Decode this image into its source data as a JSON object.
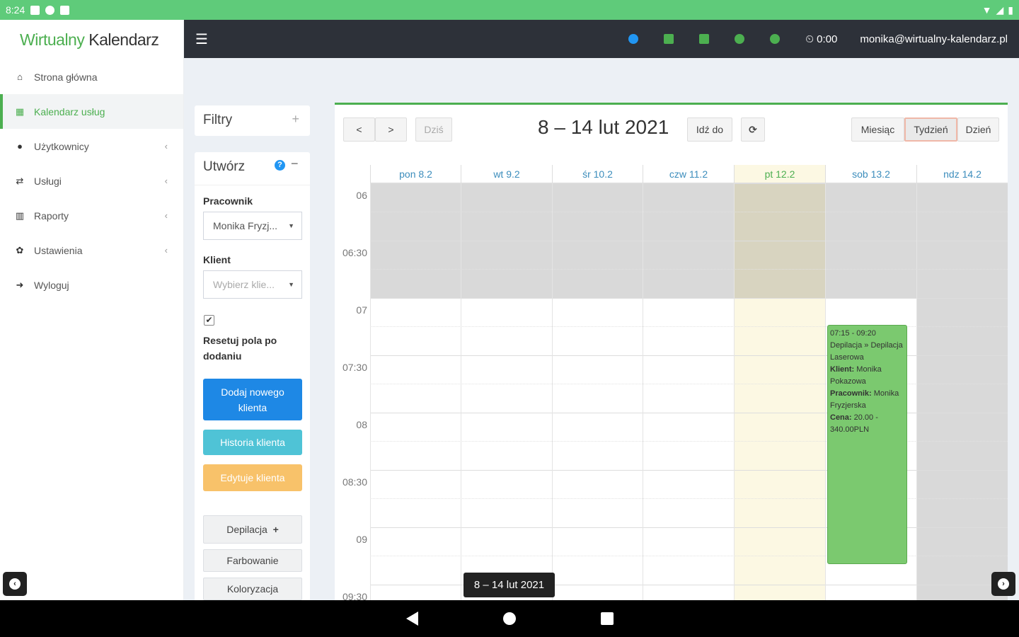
{
  "status": {
    "time": "8:24"
  },
  "sidebar": {
    "logo_green": "Wirtualny",
    "logo_dark": "Kalendarz",
    "items": [
      {
        "label": "Strona główna",
        "icon": "home-icon"
      },
      {
        "label": "Kalendarz usług",
        "icon": "calendar-icon"
      },
      {
        "label": "Użytkownicy",
        "icon": "user-icon"
      },
      {
        "label": "Usługi",
        "icon": "services-icon"
      },
      {
        "label": "Raporty",
        "icon": "bar-chart-icon"
      },
      {
        "label": "Ustawienia",
        "icon": "gear-icon"
      },
      {
        "label": "Wyloguj",
        "icon": "sign-out-icon"
      }
    ]
  },
  "topbar": {
    "timer": "0:00",
    "email": "monika@wirtualny-kalendarz.pl",
    "icon_colors": [
      "#2196f3",
      "#4caf50",
      "#4caf50",
      "#4caf50",
      "#4caf50"
    ]
  },
  "filters": {
    "title": "Filtry",
    "toggle": "+"
  },
  "create": {
    "title": "Utwórz",
    "collapse": "−",
    "employee_label": "Pracownik",
    "employee_value": "Monika Fryzj...",
    "client_label": "Klient",
    "client_placeholder": "Wybierz klie...",
    "reset_label_1": "Resetuj pola po",
    "reset_label_2": "dodaniu",
    "btn_add_1": "Dodaj nowego",
    "btn_add_2": "klienta",
    "btn_history": "Historia klienta",
    "btn_edit": "Edytuje klienta",
    "services": [
      "Depilacja",
      "Farbowanie",
      "Koloryzacja"
    ]
  },
  "calendar": {
    "prev": "<",
    "next": ">",
    "today": "Dziś",
    "title": "8 – 14 lut 2021",
    "goto": "Idź do",
    "refresh": "⟳",
    "views": [
      "Miesiąc",
      "Tydzień",
      "Dzień"
    ],
    "days": [
      "pon 8.2",
      "wt 9.2",
      "śr 10.2",
      "czw 11.2",
      "pt 12.2",
      "sob 13.2",
      "ndz 14.2"
    ],
    "times": [
      "06",
      "06:30",
      "07",
      "07:30",
      "08",
      "08:30",
      "09",
      "09:30"
    ],
    "event": {
      "time": "07:15 - 09:20",
      "service": "Depilacja » Depilacja Laserowa",
      "client_label": "Klient:",
      "client": "Monika Pokazowa",
      "worker_label": "Pracownik:",
      "worker": "Monika Fryzjerska",
      "price_label": "Cena:",
      "price": "20.00 - 340.00PLN"
    },
    "tooltip": "8 – 14 lut 2021"
  }
}
